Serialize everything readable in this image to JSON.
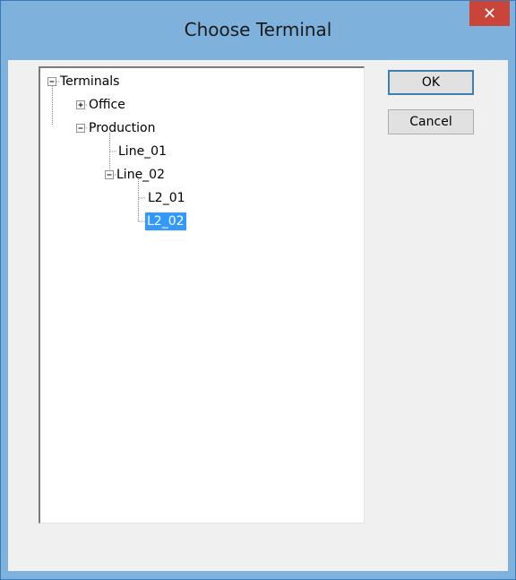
{
  "window": {
    "title": "Choose Terminal",
    "close_glyph": "✕"
  },
  "tree": {
    "root": "Terminals",
    "office": "Office",
    "production": "Production",
    "line01": "Line_01",
    "line02": "Line_02",
    "l2_01": "L2_01",
    "l2_02": "L2_02",
    "expander_open": "⊟",
    "expander_closed": "⊞",
    "selected_item": "L2_02"
  },
  "buttons": {
    "ok": "OK",
    "cancel": "Cancel"
  },
  "colors": {
    "selection": "#3399ff",
    "close_button": "#c9453a",
    "frame": "#7fb1dd"
  }
}
